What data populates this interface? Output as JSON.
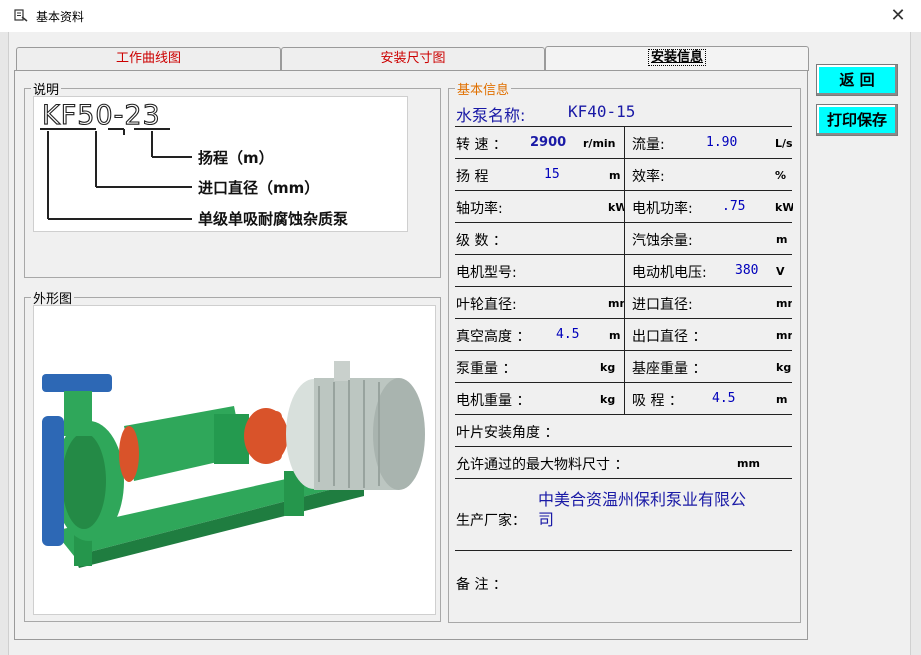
{
  "window": {
    "title": "基本资料",
    "close_glyph": "✕"
  },
  "tabs": [
    {
      "label": "工作曲线图"
    },
    {
      "label": "安装尺寸图"
    },
    {
      "label": "安装信息"
    }
  ],
  "explanation": {
    "legend": "说明",
    "model_code": "KF50-23",
    "annotations": [
      "扬程（m）",
      "进口直径（mm）",
      "单级单吸耐腐蚀杂质泵"
    ]
  },
  "appearance": {
    "legend": "外形图"
  },
  "basic_info": {
    "legend": "基本信息",
    "pump_name_label": "水泵名称:",
    "pump_name_value": "KF40-15",
    "speed_label": "转 速 ：",
    "speed_value": "2900",
    "speed_unit": "r/min",
    "flow_label": "流量:",
    "flow_value": "1.90",
    "flow_unit": "L/s",
    "head_label": "扬 程",
    "head_value": "15",
    "head_unit": "m",
    "efficiency_label": "效率:",
    "efficiency_unit": "%",
    "shaft_power_label": "轴功率:",
    "shaft_power_unit": "kW",
    "motor_power_label": "电机功率:",
    "motor_power_value": ".75",
    "motor_power_unit": "kW",
    "stages_label": "级 数 ：",
    "npsh_label": "汽蚀余量:",
    "npsh_unit": "m",
    "motor_model_label": "电机型号:",
    "motor_voltage_label": "电动机电压:",
    "motor_voltage_value": "380",
    "motor_voltage_unit": "V",
    "impeller_dia_label": "叶轮直径:",
    "impeller_dia_unit": "mm",
    "inlet_dia_label": "进口直径:",
    "inlet_dia_unit": "mm",
    "vacuum_height_label": "真空高度 ：",
    "vacuum_height_value": "4.5",
    "vacuum_height_unit": "m",
    "outlet_dia_label": "出口直径 ：",
    "outlet_dia_unit": "mm",
    "pump_weight_label": "泵重量 ：",
    "pump_weight_unit": "kg",
    "base_weight_label": "基座重量 ：",
    "base_weight_unit": "kg",
    "motor_weight_label": "电机重量 ：",
    "motor_weight_unit": "kg",
    "suction_label": "吸 程 ：",
    "suction_value": "4.5",
    "suction_unit": "m",
    "blade_angle_label": "叶片安装角度 ：",
    "max_particle_label": "允许通过的最大物料尺寸 ：",
    "max_particle_unit": "mm",
    "manufacturer_label": "生产厂家：",
    "manufacturer_line1": "中美合资温州保利泵业有限公",
    "manufacturer_line2": "司",
    "remarks_label": "备  注 ："
  },
  "buttons": {
    "back": "返  回",
    "print_save": "打印保存"
  },
  "colors": {
    "button_bg": "#00ffff",
    "tab_text": "#cc0000",
    "value_text": "#0000bb",
    "legend_accent": "#e07000",
    "pump_green": "#2fa75a",
    "flange_orange": "#d9532a"
  }
}
